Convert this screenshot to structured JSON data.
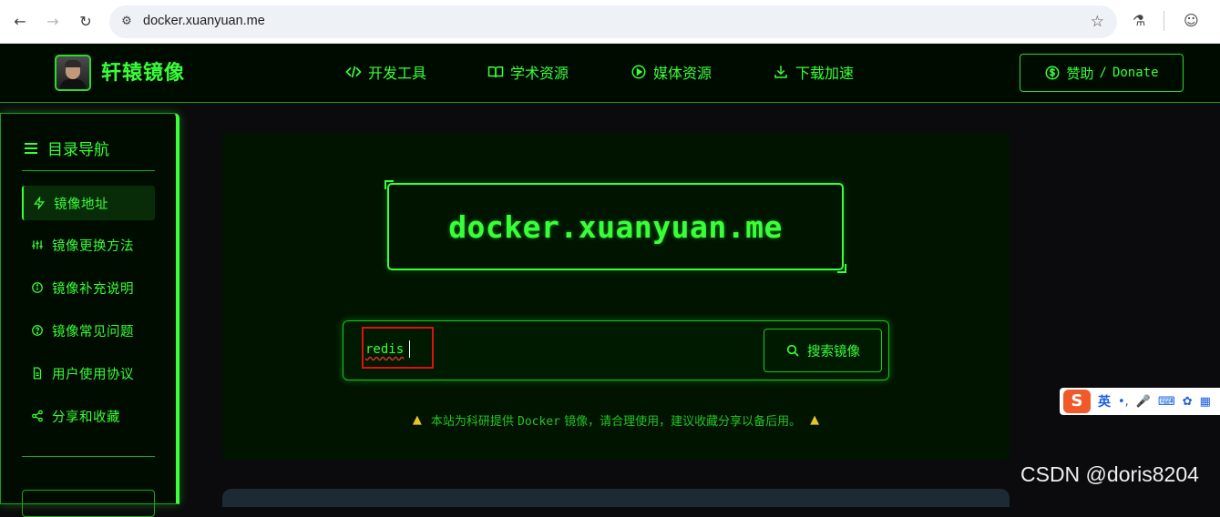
{
  "browser": {
    "url": "docker.xuanyuan.me"
  },
  "header": {
    "brand": "轩辕镜像",
    "nav": [
      {
        "label": "开发工具",
        "icon": "code-icon"
      },
      {
        "label": "学术资源",
        "icon": "book-icon"
      },
      {
        "label": "媒体资源",
        "icon": "play-circle-icon"
      },
      {
        "label": "下载加速",
        "icon": "download-icon"
      }
    ],
    "donate_cn": "赞助",
    "donate_sep": "/",
    "donate_en": "Donate"
  },
  "sidebar": {
    "title": "目录导航",
    "items": [
      {
        "label": "镜像地址",
        "icon": "bolt-icon",
        "active": true
      },
      {
        "label": "镜像更换方法",
        "icon": "sliders-icon",
        "active": false
      },
      {
        "label": "镜像补充说明",
        "icon": "info-icon",
        "active": false
      },
      {
        "label": "镜像常见问题",
        "icon": "question-icon",
        "active": false
      },
      {
        "label": "用户使用协议",
        "icon": "file-icon",
        "active": false
      },
      {
        "label": "分享和收藏",
        "icon": "share-icon",
        "active": false
      }
    ]
  },
  "main": {
    "hero": "docker.xuanyuan.me",
    "search": {
      "value": "redis",
      "button": "搜索镜像"
    },
    "notice": {
      "before": "本站为科研提供",
      "docker": "Docker",
      "after": "镜像，请合理使用，建议收藏分享以备后用。"
    }
  },
  "ime": {
    "label": "英",
    "punct": "•,"
  },
  "watermark": "CSDN @doris8204",
  "colors": {
    "accent": "#39ff39",
    "background": "#0b0b0d",
    "highlight": "#e01010",
    "warning": "#e6c623"
  }
}
